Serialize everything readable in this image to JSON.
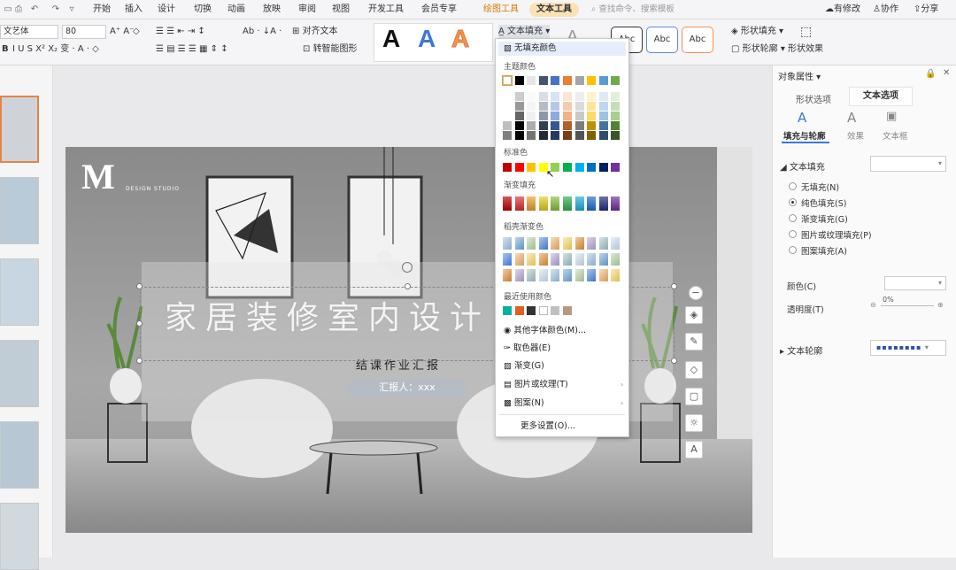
{
  "tabs": [
    "开始",
    "插入",
    "设计",
    "切换",
    "动画",
    "放映",
    "审阅",
    "视图",
    "开发工具",
    "会员专享",
    "绘图工具",
    "文本工具"
  ],
  "search_placeholder": "查找命令、搜索模板",
  "top_right": {
    "modified": "有修改",
    "collab": "协作",
    "share": "分享"
  },
  "ribbon": {
    "font_name": "文艺体",
    "font_size": "80",
    "bold": "B",
    "align_text": "对齐文本",
    "smart_shape": "转智能图形",
    "text_fill": "文本填充",
    "shape_fill": "形状填充",
    "shape_outline": "形状轮廓",
    "shape_effect": "形状效果",
    "style_a": "A",
    "abc1": "Abc",
    "abc2": "Abc",
    "abc3": "Abc"
  },
  "dropdown": {
    "no_fill": "无填充颜色",
    "theme_colors": "主题颜色",
    "standard_colors": "标准色",
    "gradient_fill": "渐变填充",
    "docer_gradient": "稻壳渐变色",
    "recent_colors": "最近使用颜色",
    "more_font_colors": "其他字体颜色(M)...",
    "eyedropper": "取色器(E)",
    "gradient": "渐变(G)",
    "picture_texture": "图片或纹理(T)",
    "pattern": "图案(N)",
    "more_settings": "更多设置(O)..."
  },
  "colors": {
    "theme_top": [
      "#ffffff",
      "#000000",
      "#e7e6e6",
      "#44546a",
      "#4472c4",
      "#ed7d31",
      "#a5a5a5",
      "#ffc000",
      "#5b9bd5",
      "#70ad47"
    ],
    "standard": [
      "#c00000",
      "#ff0000",
      "#ffc000",
      "#ffff00",
      "#92d050",
      "#00b050",
      "#00b0f0",
      "#0070c0",
      "#002060",
      "#7030a0"
    ],
    "gradient": [
      "#c00000",
      "#e03030",
      "#f0a030",
      "#e8d020",
      "#8cc040",
      "#30b050",
      "#20b0e0",
      "#2070d0",
      "#203080",
      "#7030a0"
    ],
    "recent": [
      "#00b0a0",
      "#e06020",
      "#333333",
      "#ffffff",
      "#c0c0c0",
      "#b89a80"
    ]
  },
  "slide": {
    "logo_m": "M",
    "logo_sub": "DESIGN STUDIO",
    "title": "家居装修室内设计",
    "subtitle": "结课作业汇报",
    "reporter": "汇报人：xxx"
  },
  "rightpanel": {
    "title": "对象属性",
    "tab_shape": "形状选项",
    "tab_text": "文本选项",
    "sub_fill": "填充与轮廓",
    "sub_effect": "效果",
    "sub_textbox": "文本框",
    "sec_fill": "文本填充",
    "opt_none": "无填充(N)",
    "opt_solid": "纯色填充(S)",
    "opt_gradient": "渐变填充(G)",
    "opt_picture": "图片或纹理填充(P)",
    "opt_pattern": "图案填充(A)",
    "color_label": "颜色(C)",
    "transparency_label": "透明度(T)",
    "transparency_value": "0%",
    "sec_outline": "文本轮廓"
  },
  "accent": "#e2844a"
}
